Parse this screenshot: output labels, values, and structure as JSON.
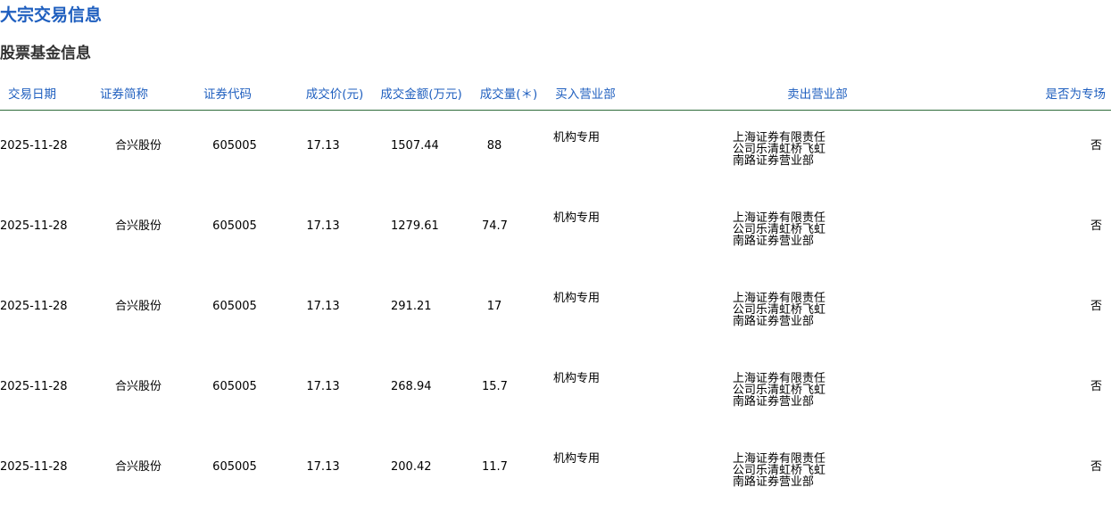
{
  "page": {
    "title": "大宗交易信息",
    "section_title": "股票基金信息"
  },
  "table": {
    "headers": [
      "交易日期",
      "证券简称",
      "证券代码",
      "成交价(元)",
      "成交金额(万元)",
      "成交量(＊)",
      "买入营业部",
      "卖出营业部",
      "是否为专场"
    ],
    "rows": [
      {
        "date": "2025-11-28",
        "name": "合兴股份",
        "code": "605005",
        "price": "17.13",
        "amount": "1507.44",
        "volume": "88",
        "buyer": "机构专用",
        "seller": "上海证券有限责任公司乐清虹桥飞虹南路证券营业部",
        "special": "否"
      },
      {
        "date": "2025-11-28",
        "name": "合兴股份",
        "code": "605005",
        "price": "17.13",
        "amount": "1279.61",
        "volume": "74.7",
        "buyer": "机构专用",
        "seller": "上海证券有限责任公司乐清虹桥飞虹南路证券营业部",
        "special": "否"
      },
      {
        "date": "2025-11-28",
        "name": "合兴股份",
        "code": "605005",
        "price": "17.13",
        "amount": "291.21",
        "volume": "17",
        "buyer": "机构专用",
        "seller": "上海证券有限责任公司乐清虹桥飞虹南路证券营业部",
        "special": "否"
      },
      {
        "date": "2025-11-28",
        "name": "合兴股份",
        "code": "605005",
        "price": "17.13",
        "amount": "268.94",
        "volume": "15.7",
        "buyer": "机构专用",
        "seller": "上海证券有限责任公司乐清虹桥飞虹南路证券营业部",
        "special": "否"
      },
      {
        "date": "2025-11-28",
        "name": "合兴股份",
        "code": "605005",
        "price": "17.13",
        "amount": "200.42",
        "volume": "11.7",
        "buyer": "机构专用",
        "seller": "上海证券有限责任公司乐清虹桥飞虹南路证券营业部",
        "special": "否"
      }
    ]
  }
}
